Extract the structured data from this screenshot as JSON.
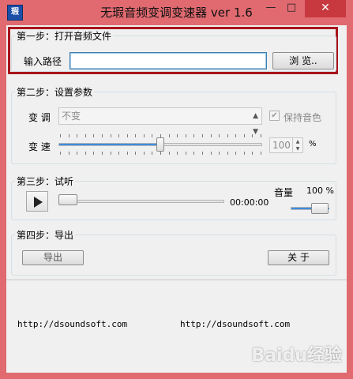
{
  "window": {
    "title": "无瑕音频变调变速器 ver 1.6",
    "icon_label": "瑕",
    "min_glyph": "—",
    "max_glyph": "□",
    "close_glyph": "✕"
  },
  "step1": {
    "legend": "第一步：打开音频文件",
    "path_label": "输入路径",
    "path_value": "",
    "browse_label": "浏 览.."
  },
  "step2": {
    "legend": "第二步：设置参数",
    "pitch_label": "变 调",
    "pitch_value": "不变",
    "keep_tone_label": "保持音色",
    "keep_tone_checked": true,
    "speed_label": "变 速",
    "speed_value": "100",
    "speed_unit": "%",
    "speed_slider_fraction": 0.5
  },
  "step3": {
    "legend": "第三步：试听",
    "time": "00:00:00",
    "volume_label": "音量",
    "volume_value": "100 %",
    "progress_fraction": 0.0,
    "volume_fraction": 1.0
  },
  "step4": {
    "legend": "第四步：导出",
    "export_label": "导出",
    "about_label": "关 于"
  },
  "footer": {
    "url_left": "http://dsoundsoft.com",
    "url_right": "http://dsoundsoft.com"
  },
  "watermark": "Baidu经验",
  "colors": {
    "frame": "#e06a70",
    "highlight": "#a8141c",
    "accent": "#3d8ee0"
  }
}
